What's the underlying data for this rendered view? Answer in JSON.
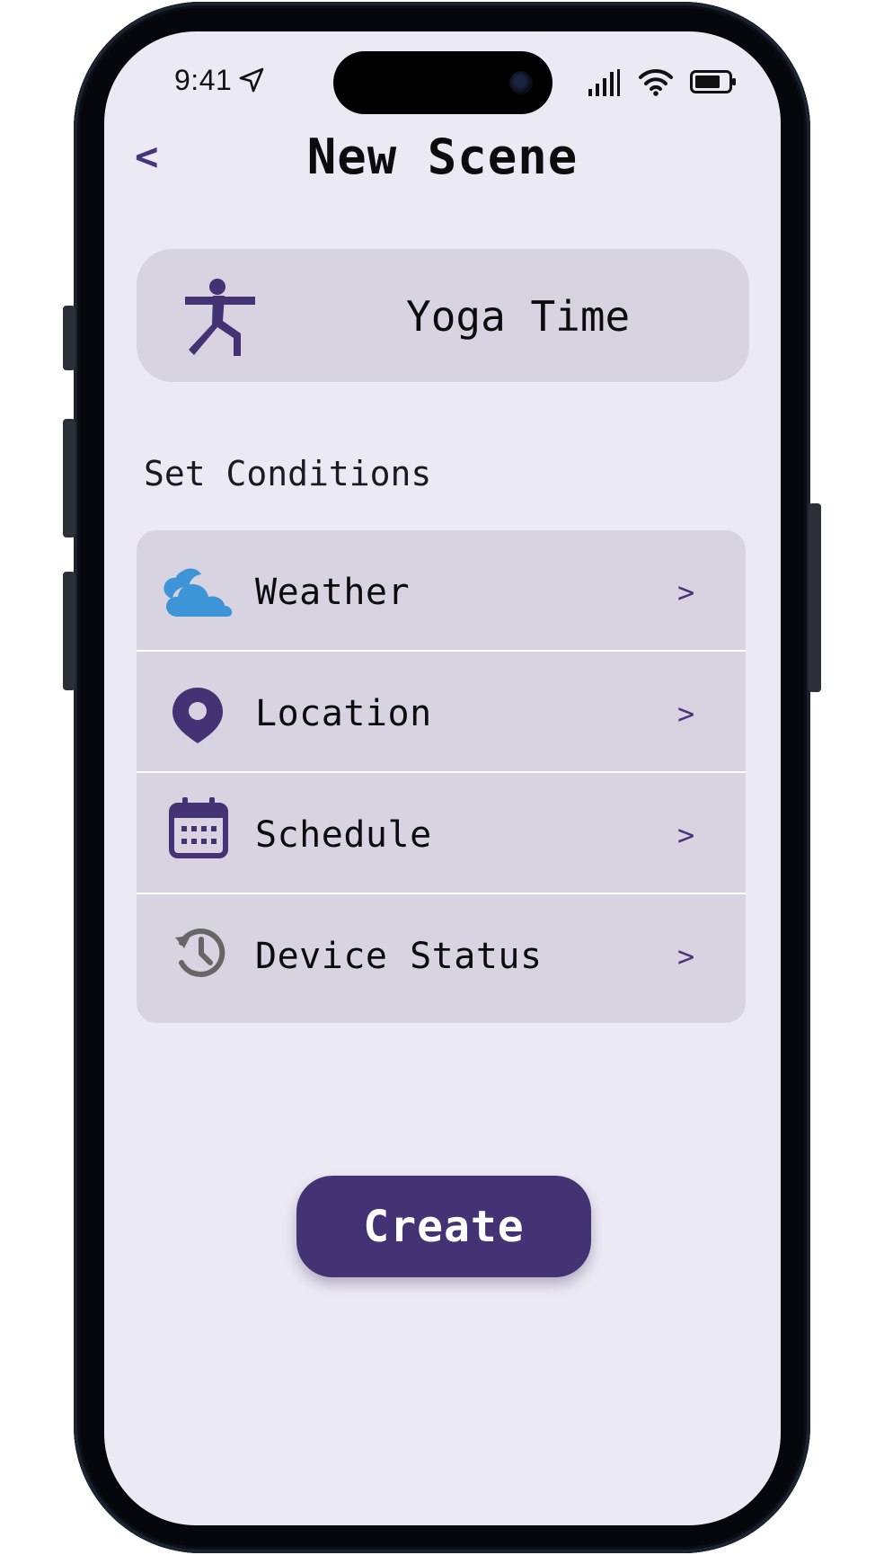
{
  "status_bar": {
    "time": "9:41",
    "icons": [
      "location-arrow-icon",
      "cellular-signal-icon",
      "wifi-icon",
      "battery-icon"
    ]
  },
  "header": {
    "back_label": "<",
    "title": "New Scene"
  },
  "scene": {
    "icon": "yoga-pose-icon",
    "name": "Yoga Time"
  },
  "conditions": {
    "section_label": "Set Conditions",
    "items": [
      {
        "label": "Weather",
        "icon": "cloud-icon",
        "chevron": ">"
      },
      {
        "label": "Location",
        "icon": "location-pin-icon",
        "chevron": ">"
      },
      {
        "label": "Schedule",
        "icon": "calendar-icon",
        "chevron": ">"
      },
      {
        "label": "Device Status",
        "icon": "history-icon",
        "chevron": ">"
      }
    ]
  },
  "actions": {
    "create_label": "Create"
  },
  "colors": {
    "accent": "#433374",
    "screen_background": "#ebe9f3",
    "card_background": "#d8d3e1",
    "weather_icon": "#3d95d8",
    "history_icon": "#666666"
  }
}
